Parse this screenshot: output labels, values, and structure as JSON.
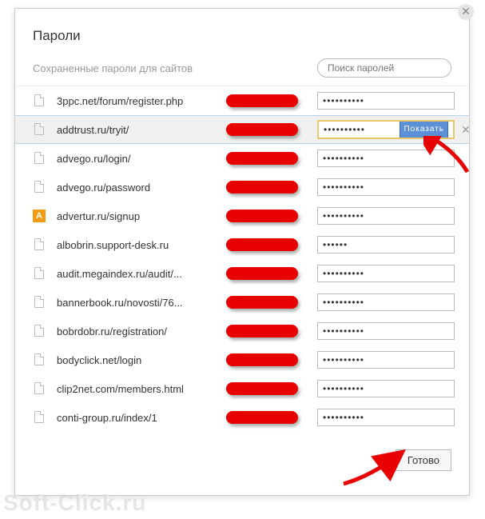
{
  "dialog": {
    "title": "Пароли",
    "subtitle": "Сохраненные пароли для сайтов",
    "search_placeholder": "Поиск паролей",
    "show_button_label": "Показать",
    "done_button_label": "Готово",
    "close_glyph": "✕",
    "row_close_glyph": "✕"
  },
  "passwords": [
    {
      "site": "3ppc.net/forum/register.php",
      "icon": "file",
      "dots": "••••••••••",
      "selected": false
    },
    {
      "site": "addtrust.ru/tryit/",
      "icon": "file",
      "dots": "••••••••••",
      "selected": true
    },
    {
      "site": "advego.ru/login/",
      "icon": "file",
      "dots": "••••••••••",
      "selected": false
    },
    {
      "site": "advego.ru/password",
      "icon": "file",
      "dots": "••••••••••",
      "selected": false
    },
    {
      "site": "advertur.ru/signup",
      "icon": "letter-a",
      "dots": "••••••••••",
      "selected": false
    },
    {
      "site": "albobrin.support-desk.ru",
      "icon": "file",
      "dots": "••••••",
      "selected": false
    },
    {
      "site": "audit.megaindex.ru/audit/...",
      "icon": "file",
      "dots": "••••••••••",
      "selected": false
    },
    {
      "site": "bannerbook.ru/novosti/76...",
      "icon": "file",
      "dots": "••••••••••",
      "selected": false
    },
    {
      "site": "bobrdobr.ru/registration/",
      "icon": "file",
      "dots": "••••••••••",
      "selected": false
    },
    {
      "site": "bodyclick.net/login",
      "icon": "file",
      "dots": "••••••••••",
      "selected": false
    },
    {
      "site": "clip2net.com/members.html",
      "icon": "file",
      "dots": "••••••••••",
      "selected": false
    },
    {
      "site": "conti-group.ru/index/1",
      "icon": "file",
      "dots": "••••••••••",
      "selected": false
    }
  ],
  "watermark": "Soft-Click.ru",
  "favicon_letter": "A"
}
